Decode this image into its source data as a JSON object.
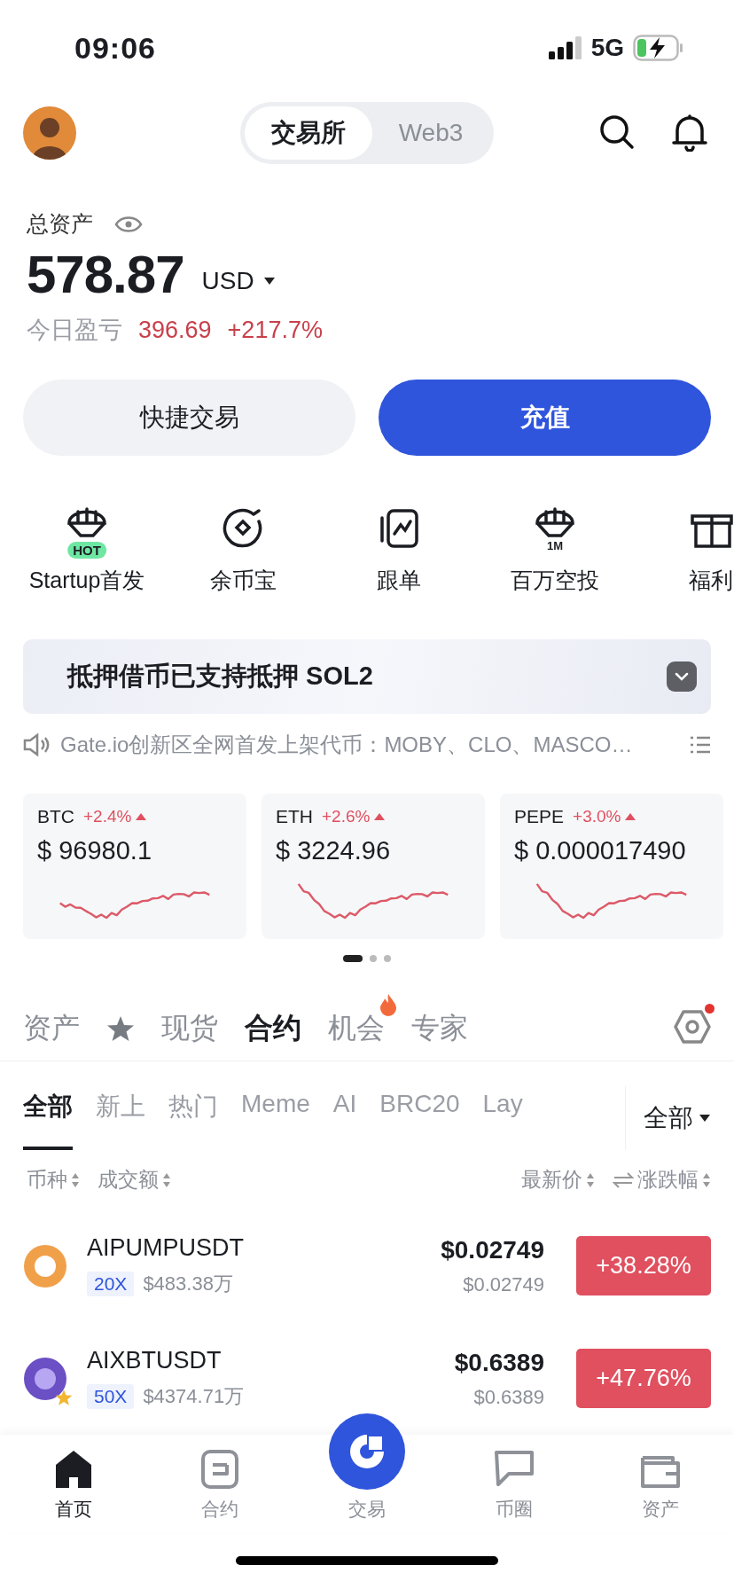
{
  "status_bar": {
    "time": "09:06",
    "network": "5G"
  },
  "header": {
    "segments": [
      {
        "label": "交易所",
        "selected": true
      },
      {
        "label": "Web3",
        "selected": false
      }
    ]
  },
  "assets": {
    "label": "总资产",
    "amount": "578.87",
    "currency": "USD",
    "pnl_label": "今日盈亏",
    "pnl_value": "396.69",
    "pnl_percent": "+217.7%"
  },
  "actions": [
    {
      "label": "快捷交易",
      "kind": "secondary"
    },
    {
      "label": "充值",
      "kind": "primary"
    }
  ],
  "shortcuts": [
    {
      "label": "Startup首发",
      "kind": "parachute",
      "badge": "HOT"
    },
    {
      "label": "余币宝",
      "kind": "coin"
    },
    {
      "label": "跟单",
      "kind": "chart"
    },
    {
      "label": "百万空投",
      "kind": "parachute",
      "icon_text": "1M"
    },
    {
      "label": "福利",
      "kind": "gift"
    }
  ],
  "banner": {
    "text": "抵押借币已支持抵押 SOL2"
  },
  "notice": {
    "text": "Gate.io创新区全网首发上架代币：MOBY、CLO、MASCO…"
  },
  "tickers": [
    {
      "symbol": "BTC",
      "change": "+2.4%",
      "price": "$ 96980.1"
    },
    {
      "symbol": "ETH",
      "change": "+2.6%",
      "price": "$ 3224.96"
    },
    {
      "symbol": "PEPE",
      "change": "+3.0%",
      "price": "$ 0.000017490"
    }
  ],
  "ticker_pages": [
    {
      "selected": true
    },
    {
      "selected": false
    },
    {
      "selected": false
    }
  ],
  "market_tabs": [
    {
      "kind": "text",
      "label": "资产",
      "selected": false
    },
    {
      "kind": "star",
      "selected": false
    },
    {
      "kind": "text",
      "label": "现货",
      "selected": false
    },
    {
      "kind": "text",
      "label": "合约",
      "selected": true
    },
    {
      "kind": "text",
      "label": "机会",
      "selected": false,
      "hot": true
    },
    {
      "kind": "text",
      "label": "专家",
      "selected": false
    }
  ],
  "market_settings": {
    "has_update": true
  },
  "category_tabs": [
    {
      "label": "全部",
      "selected": true
    },
    {
      "label": "新上",
      "selected": false
    },
    {
      "label": "热门",
      "selected": false
    },
    {
      "label": "Meme",
      "selected": false
    },
    {
      "label": "AI",
      "selected": false
    },
    {
      "label": "BRC20",
      "selected": false
    },
    {
      "label": "Lay",
      "selected": false
    }
  ],
  "category_filter": "全部",
  "columns": [
    {
      "label": "币种"
    },
    {
      "label": "成交额"
    },
    {
      "label": "最新价"
    },
    {
      "label": "涨跌幅",
      "swap": true
    }
  ],
  "rows": [
    {
      "symbol": "AIPUMPUSDT",
      "leverage": "20X",
      "volume": "$483.38万",
      "price": "$0.02749",
      "price_sub": "$0.02749",
      "change": "+38.28%",
      "favorite": false
    },
    {
      "symbol": "AIXBTUSDT",
      "leverage": "50X",
      "volume": "$4374.71万",
      "price": "$0.6389",
      "price_sub": "$0.6389",
      "change": "+47.76%",
      "favorite": true
    }
  ],
  "nav": [
    {
      "label": "首页",
      "kind": "home",
      "selected": true
    },
    {
      "label": "合约",
      "kind": "futures",
      "selected": false
    },
    {
      "label": "交易",
      "kind": "trade",
      "selected": false
    },
    {
      "label": "币圈",
      "kind": "chat",
      "selected": false
    },
    {
      "label": "资产",
      "kind": "wallet",
      "selected": false
    }
  ]
}
